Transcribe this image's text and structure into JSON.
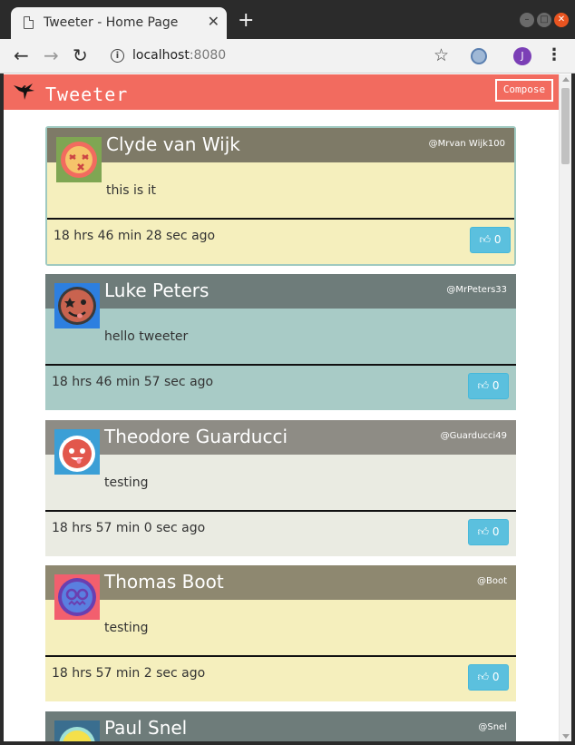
{
  "browser": {
    "tab_title": "Tweeter - Home Page",
    "new_tab": "+",
    "url_host": "localhost",
    "url_port": ":8080",
    "profile_initial": "J"
  },
  "app": {
    "title": "Tweeter",
    "compose_label": "Compose",
    "accent_color": "#f26b5f"
  },
  "tweets": [
    {
      "name": "Clyde van Wijk",
      "handle": "@Mrvan Wijk100",
      "text": "this is it",
      "time": "18 hrs 46 min 28 sec ago",
      "likes": "0",
      "avatar": "dizzy-face-avatar"
    },
    {
      "name": "Luke Peters",
      "handle": "@MrPeters33",
      "text": "hello tweeter",
      "time": "18 hrs 46 min 57 sec ago",
      "likes": "0",
      "avatar": "star-eyes-face-avatar"
    },
    {
      "name": "Theodore Guarducci",
      "handle": "@Guarducci49",
      "text": "testing",
      "time": "18 hrs 57 min 0 sec ago",
      "likes": "0",
      "avatar": "horned-face-avatar"
    },
    {
      "name": "Thomas Boot",
      "handle": "@Boot",
      "text": "testing",
      "time": "18 hrs 57 min 2 sec ago",
      "likes": "0",
      "avatar": "goggle-face-avatar"
    },
    {
      "name": "Paul Snel",
      "handle": "@Snel",
      "text": "",
      "time": "",
      "likes": "",
      "avatar": "smile-face-avatar"
    }
  ]
}
